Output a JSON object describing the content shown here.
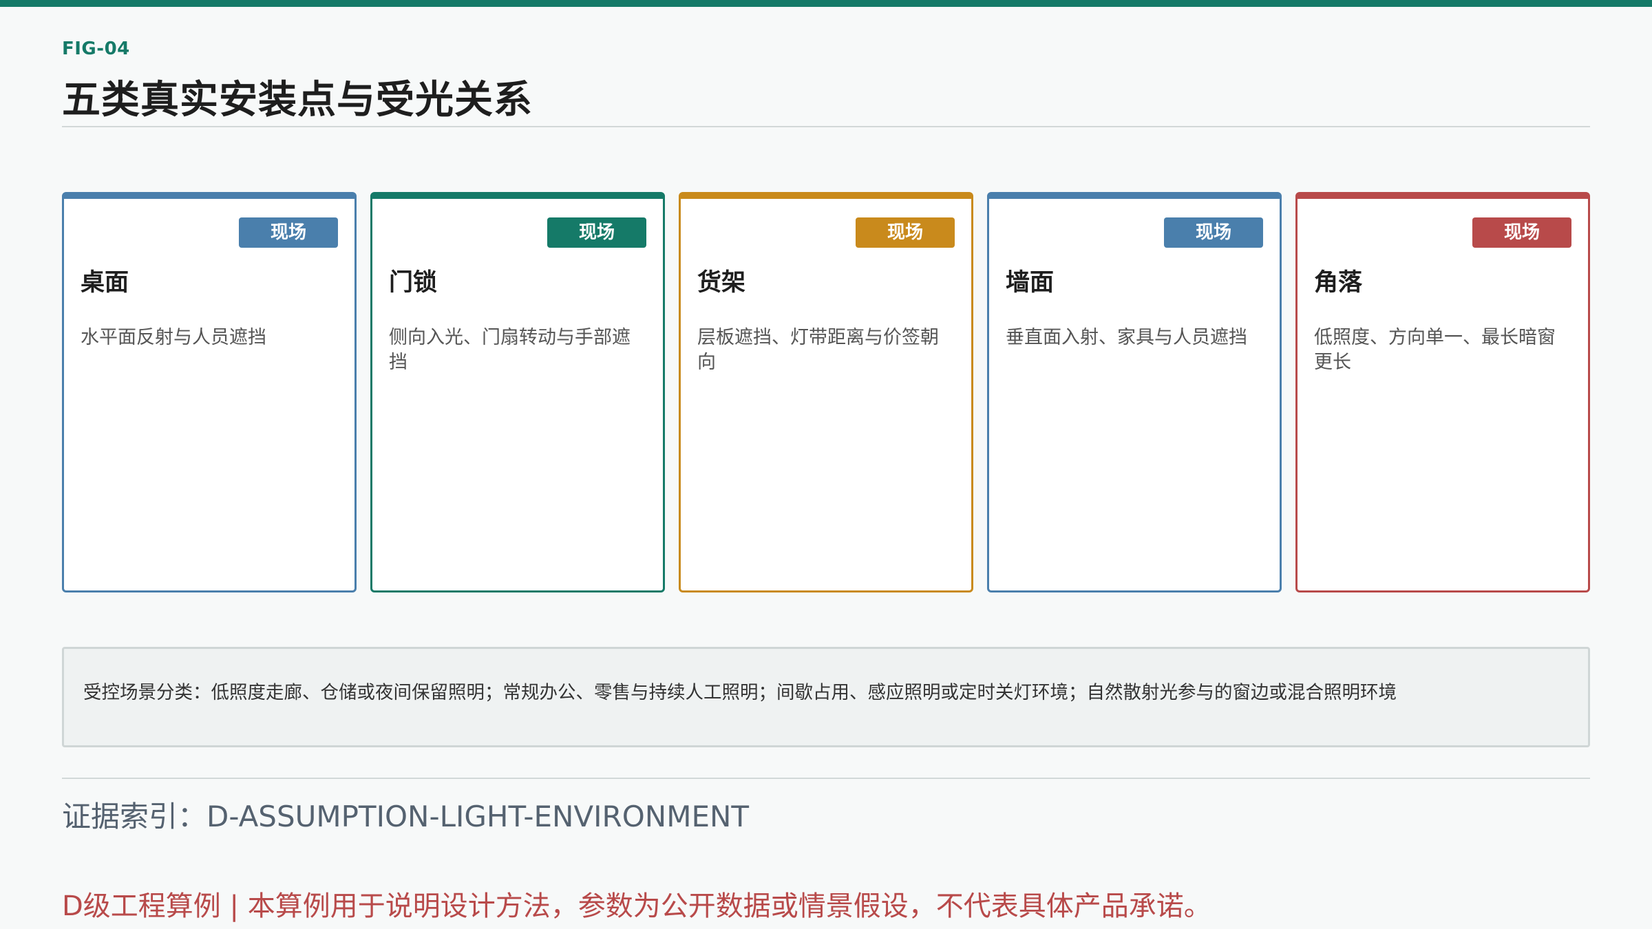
{
  "header": {
    "fig_label": "FIG-04",
    "title": "五类真实安装点与受光关系"
  },
  "cards": [
    {
      "badge": "现场",
      "title": "桌面",
      "desc": "水平面反射与人员遮挡",
      "color": "#4a7fac"
    },
    {
      "badge": "现场",
      "title": "门锁",
      "desc": "侧向入光、门扇转动与手部遮挡",
      "color": "#157a68"
    },
    {
      "badge": "现场",
      "title": "货架",
      "desc": "层板遮挡、灯带距离与价签朝向",
      "color": "#c98a1c"
    },
    {
      "badge": "现场",
      "title": "墙面",
      "desc": "垂直面入射、家具与人员遮挡",
      "color": "#4a7fac"
    },
    {
      "badge": "现场",
      "title": "角落",
      "desc": "低照度、方向单一、最长暗窗更长",
      "color": "#b84a4a"
    }
  ],
  "note": {
    "text": "受控场景分类：低照度走廊、仓储或夜间保留照明；常规办公、零售与持续人工照明；间歇占用、感应照明或定时关灯环境；自然散射光参与的窗边或混合照明环境"
  },
  "footer": {
    "evidence": "证据索引：D-ASSUMPTION-LIGHT-ENVIRONMENT",
    "disclaimer": "D级工程算例 | 本算例用于说明设计方法，参数为公开数据或情景假设，不代表具体产品承诺。"
  }
}
